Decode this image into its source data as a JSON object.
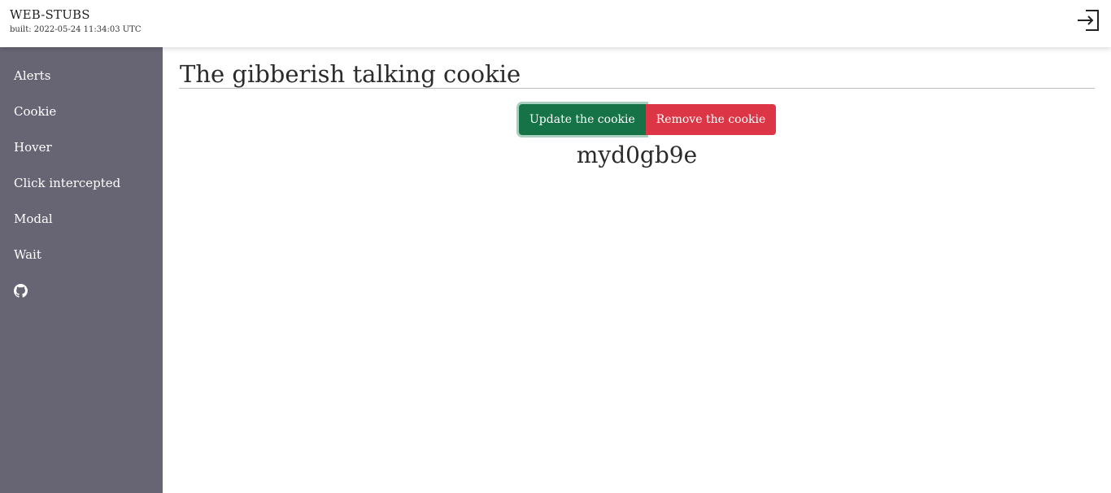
{
  "header": {
    "title": "WEB-STUBS",
    "build_info": "built: 2022-05-24 11:34:03 UTC",
    "logout_icon": "sign-in-icon"
  },
  "sidebar": {
    "items": [
      {
        "label": "Alerts"
      },
      {
        "label": "Cookie"
      },
      {
        "label": "Hover"
      },
      {
        "label": "Click intercepted"
      },
      {
        "label": "Modal"
      },
      {
        "label": "Wait"
      }
    ],
    "github_icon": "github-icon"
  },
  "main": {
    "title": "The gibberish talking cookie",
    "buttons": {
      "update_label": "Update the cookie",
      "remove_label": "Remove the cookie"
    },
    "cookie_value": "myd0gb9e"
  },
  "colors": {
    "sidebar_bg": "#676573",
    "update_button": "#157347",
    "remove_button": "#dc3545"
  }
}
